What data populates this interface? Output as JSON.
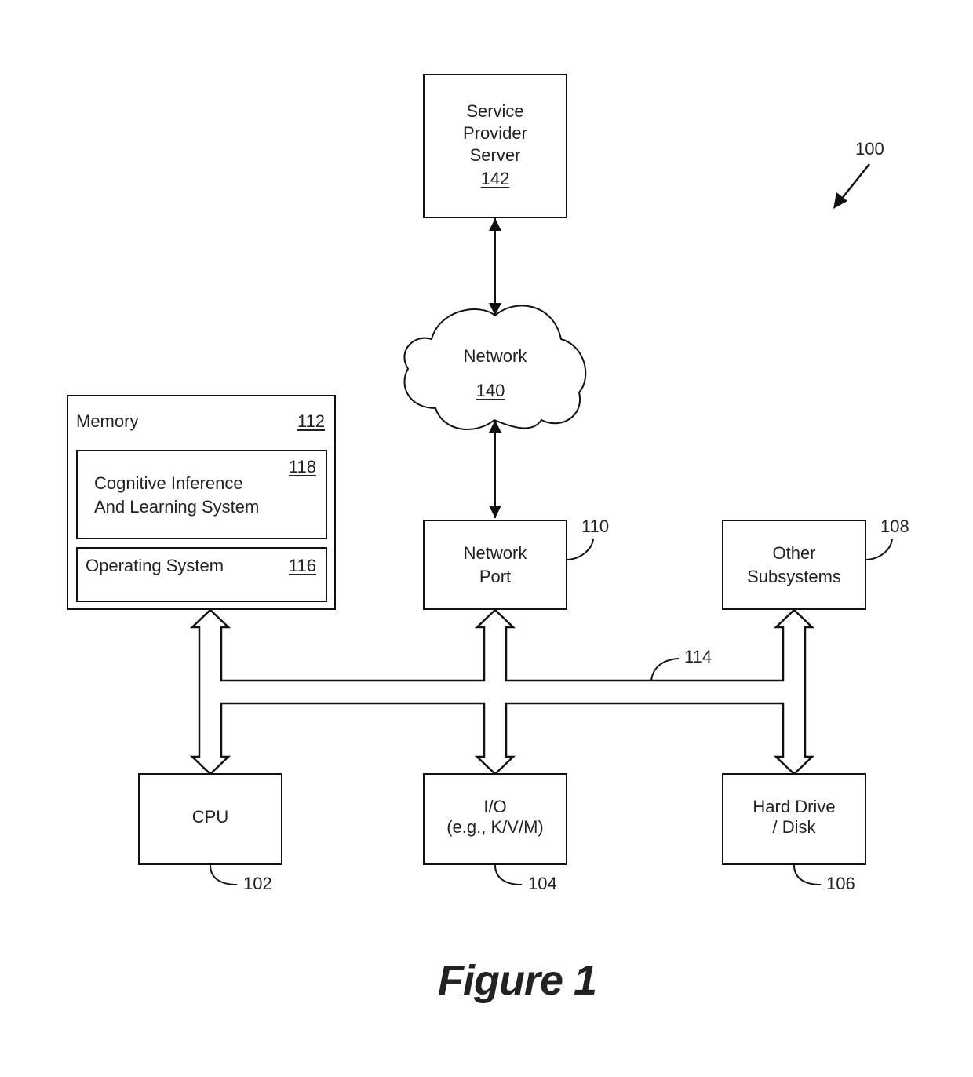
{
  "figure": {
    "caption": "Figure 1",
    "system_ref": "100"
  },
  "components": {
    "service_provider_server": {
      "lines": [
        "Service",
        "Provider",
        "Server"
      ],
      "ref": "142"
    },
    "network": {
      "label": "Network",
      "ref": "140"
    },
    "memory": {
      "label": "Memory",
      "ref": "112",
      "cognitive_system": {
        "lines": [
          "Cognitive Inference",
          "And Learning System"
        ],
        "ref": "118"
      },
      "operating_system": {
        "label": "Operating System",
        "ref": "116"
      }
    },
    "network_port": {
      "lines": [
        "Network",
        "Port"
      ],
      "ref": "110"
    },
    "other_subsystems": {
      "lines": [
        "Other",
        "Subsystems"
      ],
      "ref": "108"
    },
    "bus": {
      "ref": "114"
    },
    "cpu": {
      "label": "CPU",
      "ref": "102"
    },
    "io": {
      "lines": [
        "I/O",
        "(e.g., K/V/M)"
      ],
      "ref": "104"
    },
    "hard_drive": {
      "lines": [
        "Hard Drive",
        "/ Disk"
      ],
      "ref": "106"
    }
  }
}
